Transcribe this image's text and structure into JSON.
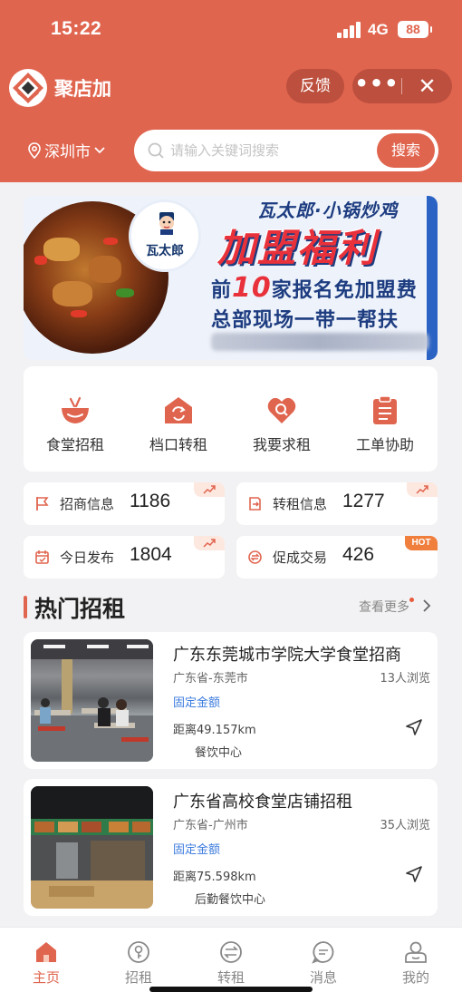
{
  "status_bar": {
    "time": "15:22",
    "network": "4G",
    "battery": "88"
  },
  "header": {
    "app_name": "聚店加",
    "feedback": "反馈",
    "menu_dots": "•••",
    "close": "✕",
    "city": "深圳市",
    "search_placeholder": "请输入关键词搜索",
    "search_button": "搜索"
  },
  "banner": {
    "brand": "瓦太郎",
    "headline_top": "瓦太郎·小锅炒鸡",
    "headline_big": "加盟福利",
    "line1_pre": "前",
    "line1_num": "10",
    "line1_post": "家报名免加盟费",
    "line2": "总部现场一带一帮扶"
  },
  "menu": [
    {
      "label": "食堂招租",
      "icon": "bowl-icon"
    },
    {
      "label": "档口转租",
      "icon": "shop-swap-icon"
    },
    {
      "label": "我要求租",
      "icon": "heart-search-icon"
    },
    {
      "label": "工单协助",
      "icon": "clipboard-icon"
    }
  ],
  "stats": [
    {
      "label": "招商信息",
      "value": "1186",
      "icon": "flag-icon",
      "tag": "trend"
    },
    {
      "label": "转租信息",
      "value": "1277",
      "icon": "transfer-icon",
      "tag": "trend"
    },
    {
      "label": "今日发布",
      "value": "1804",
      "icon": "calendar-icon",
      "tag": "trend"
    },
    {
      "label": "促成交易",
      "value": "426",
      "icon": "deal-icon",
      "tag": "HOT"
    }
  ],
  "section": {
    "title": "热门招租",
    "more": "查看更多"
  },
  "listings": [
    {
      "title": "广东东莞城市学院大学食堂招商",
      "region": "广东省-东莞市",
      "views": "13人浏览",
      "price_type": "固定金额",
      "distance": "距离49.157km",
      "category": "餐饮中心"
    },
    {
      "title": "广东省高校食堂店铺招租",
      "region": "广东省-广州市",
      "views": "35人浏览",
      "price_type": "固定金额",
      "distance": "距离75.598km",
      "category": "后勤餐饮中心"
    }
  ],
  "tabs": [
    {
      "label": "主页",
      "icon": "home-icon",
      "active": true
    },
    {
      "label": "招租",
      "icon": "key-icon",
      "active": false
    },
    {
      "label": "转租",
      "icon": "swap-icon",
      "active": false
    },
    {
      "label": "消息",
      "icon": "message-icon",
      "active": false
    },
    {
      "label": "我的",
      "icon": "profile-icon",
      "active": false
    }
  ],
  "colors": {
    "primary": "#e0654f",
    "link": "#3b7bde",
    "hot": "#f07f3e",
    "background": "#f2f2f4"
  }
}
